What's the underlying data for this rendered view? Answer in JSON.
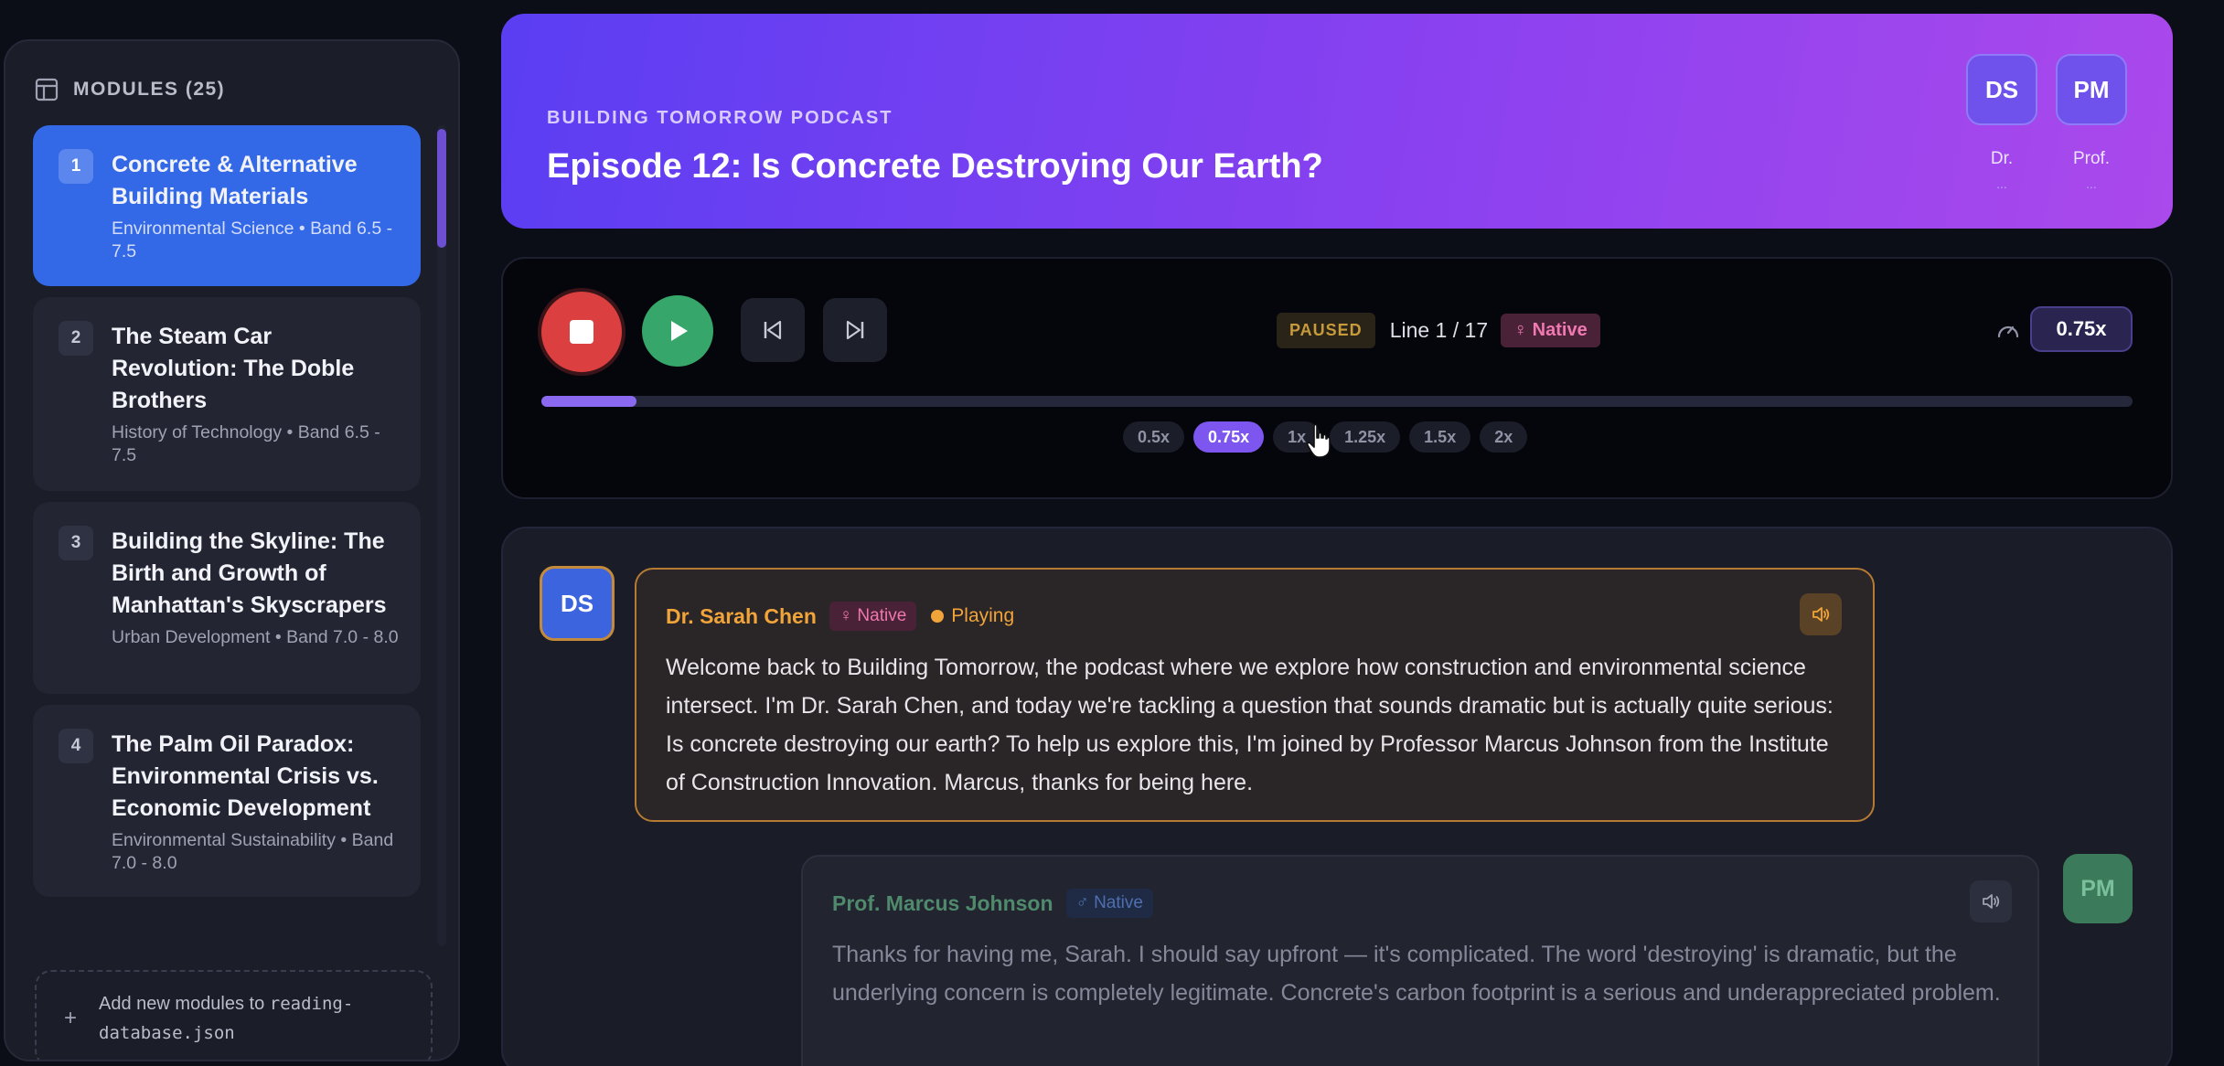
{
  "sidebar": {
    "title": "MODULES (25)",
    "modules": [
      {
        "num": "1",
        "title": "Concrete & Alternative Building Materials",
        "subtitle": "Environmental Science • Band 6.5 - 7.5"
      },
      {
        "num": "2",
        "title": "The Steam Car Revolution: The Doble Brothers",
        "subtitle": "History of Technology • Band 6.5 - 7.5"
      },
      {
        "num": "3",
        "title": "Building the Skyline: The Birth and Growth of Manhattan's Skyscrapers",
        "subtitle": "Urban Development • Band 7.0 - 8.0"
      },
      {
        "num": "4",
        "title": "The Palm Oil Paradox: Environmental Crisis vs. Economic Development",
        "subtitle": "Environmental Sustainability • Band 7.0 - 8.0"
      }
    ],
    "add_prefix": "Add new modules to ",
    "add_file": "reading-database.json"
  },
  "header": {
    "kicker": "BUILDING TOMORROW PODCAST",
    "title": "Episode 12: Is Concrete Destroying Our Earth?",
    "speakers": [
      {
        "initials": "DS",
        "name": "Dr.",
        "more": "..."
      },
      {
        "initials": "PM",
        "name": "Prof.",
        "more": "..."
      }
    ]
  },
  "player": {
    "status": "PAUSED",
    "line_info": "Line 1 / 17",
    "voice_badge": "♀ Native",
    "current_speed": "0.75x",
    "progress": 0.06,
    "speed_options": [
      "0.5x",
      "0.75x",
      "1x",
      "1.25x",
      "1.5x",
      "2x"
    ],
    "active_speed_index": 1
  },
  "transcript": {
    "messages": [
      {
        "initials": "DS",
        "speaker": "Dr. Sarah Chen",
        "badge": "♀ Native",
        "state": "Playing",
        "text": "Welcome back to Building Tomorrow, the podcast where we explore how construction and environmental science intersect. I'm Dr. Sarah Chen, and today we're tackling a question that sounds dramatic but is actually quite serious: Is concrete destroying our earth? To help us explore this, I'm joined by Professor Marcus Johnson from the Institute of Construction Innovation. Marcus, thanks for being here."
      },
      {
        "initials": "PM",
        "speaker": "Prof. Marcus Johnson",
        "badge": "♂ Native",
        "text": "Thanks for having me, Sarah. I should say upfront — it's complicated. The word 'destroying' is dramatic, but the underlying concern is completely legitimate. Concrete's carbon footprint is a serious and underappreciated problem."
      }
    ]
  },
  "colors": {
    "accent": "#7d56ef",
    "active_module": "#3368e6",
    "playing": "#f0a43a",
    "stop": "#dc3f3f",
    "play": "#36a66a"
  }
}
